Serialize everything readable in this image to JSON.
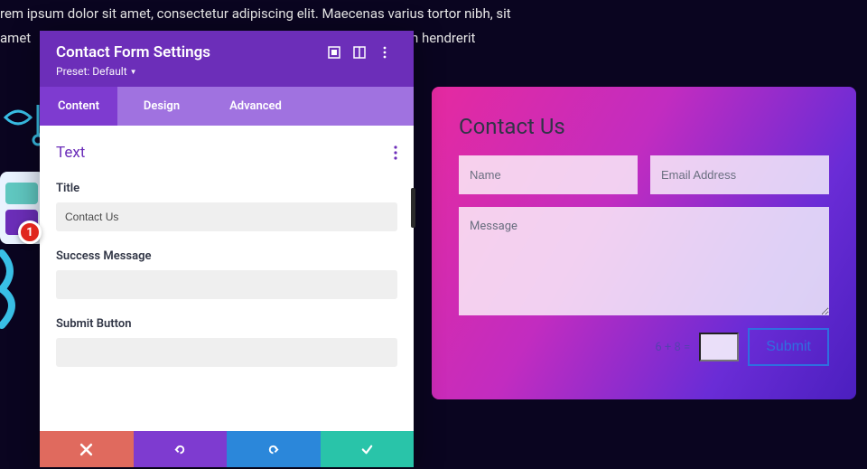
{
  "bg_text": {
    "line1": "rem ipsum dolor sit amet, consectetur adipiscing elit. Maecenas varius tortor nibh, sit",
    "line2_a": "amet",
    "line2_b": "uam hendrerit"
  },
  "panel": {
    "title": "Contact Form Settings",
    "preset_label": "Preset: Default",
    "tabs": {
      "content": "Content",
      "design": "Design",
      "advanced": "Advanced"
    },
    "section": "Text",
    "fields": {
      "title_label": "Title",
      "title_value": "Contact Us",
      "success_label": "Success Message",
      "success_value": "",
      "submit_label": "Submit Button",
      "submit_value": ""
    }
  },
  "badge": "1",
  "form": {
    "title": "Contact Us",
    "name_ph": "Name",
    "email_ph": "Email Address",
    "message_ph": "Message",
    "captcha": "6 + 8 =",
    "submit": "Submit"
  }
}
